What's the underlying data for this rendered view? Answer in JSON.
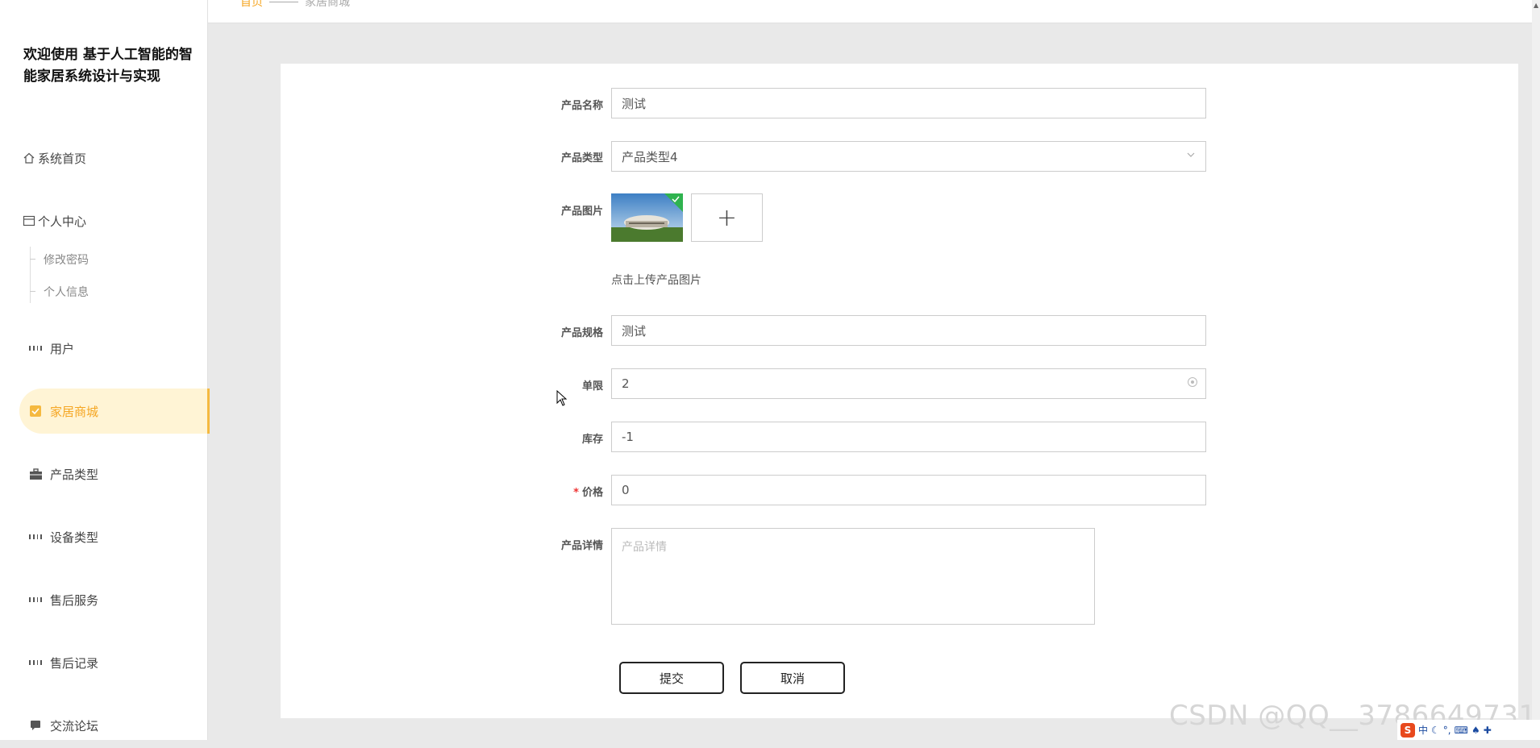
{
  "app": {
    "title": "欢迎使用 基于人工智能的智能家居系统设计与实现"
  },
  "breadcrumb": {
    "home": "首页",
    "current": "家居商城"
  },
  "sidebar": {
    "items": [
      {
        "label": "系统首页",
        "icon": "home-icon"
      },
      {
        "label": "个人中心",
        "icon": "card-icon"
      },
      {
        "label": "修改密码",
        "icon": ""
      },
      {
        "label": "个人信息",
        "icon": ""
      },
      {
        "label": "用户",
        "icon": "grid-icon"
      },
      {
        "label": "家居商城",
        "icon": "checkbox-icon",
        "active": true
      },
      {
        "label": "产品类型",
        "icon": "briefcase-icon"
      },
      {
        "label": "设备类型",
        "icon": "grid-icon"
      },
      {
        "label": "售后服务",
        "icon": "grid-icon"
      },
      {
        "label": "售后记录",
        "icon": "grid-icon"
      },
      {
        "label": "交流论坛",
        "icon": "chat-icon"
      }
    ]
  },
  "form": {
    "product_name": {
      "label": "产品名称",
      "value": "测试"
    },
    "product_type": {
      "label": "产品类型",
      "value": "产品类型4"
    },
    "product_image": {
      "label": "产品图片",
      "hint": "点击上传产品图片",
      "add_symbol": "+"
    },
    "product_spec": {
      "label": "产品规格",
      "value": "测试"
    },
    "limit": {
      "label": "单限",
      "value": "2"
    },
    "stock": {
      "label": "库存",
      "value": "-1"
    },
    "price": {
      "label": "价格",
      "value": "0",
      "required_mark": "*"
    },
    "detail": {
      "label": "产品详情",
      "placeholder": "产品详情"
    },
    "submit_label": "提交",
    "cancel_label": "取消"
  },
  "watermark": "CSDN @QQ__3786649731",
  "tray": {
    "ime_badge": "S",
    "ime_lang": "中"
  },
  "colors": {
    "accent": "#f5a623",
    "active_bg": "#fff4d5"
  }
}
